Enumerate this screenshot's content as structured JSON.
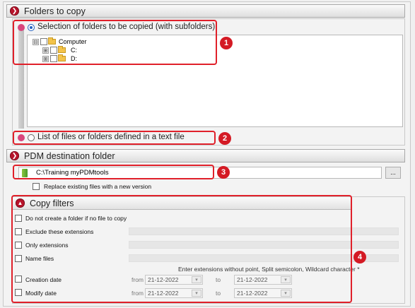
{
  "sections": {
    "folders_to_copy": {
      "title": "Folders to copy"
    },
    "pdm_destination": {
      "title": "PDM destination folder"
    },
    "copy_filters": {
      "title": "Copy filters"
    }
  },
  "source_options": {
    "selection_label": "Selection of folders to be copied (with subfolders)",
    "list_file_label": "List of files or folders defined in a text file",
    "selected": "selection"
  },
  "tree": {
    "root": {
      "label": "Computer",
      "expander": "⊟"
    },
    "children": [
      {
        "label": "C:",
        "expander": "⊞"
      },
      {
        "label": "D:",
        "expander": "⊞"
      }
    ]
  },
  "destination": {
    "path": "C:\\Training myPDMtools",
    "browse_label": "...",
    "replace_label": "Replace existing files with a new version"
  },
  "filters": {
    "no_folder_label": "Do not create a folder if no file to copy",
    "exclude_label": "Exclude these extensions",
    "only_label": "Only extensions",
    "name_label": "Name files",
    "hint": "Enter extensions without point, Split semicolon, Wildcard character *",
    "creation_label": "Creation date",
    "modify_label": "Modify date",
    "from_label": "from",
    "to_label": "to",
    "creation_from": "21-12-2022",
    "creation_to": "21-12-2022",
    "modify_from": "21-12-2022",
    "modify_to": "21-12-2022"
  },
  "callouts": [
    "1",
    "2",
    "3",
    "4"
  ],
  "colors": {
    "callout_red": "#e0202a",
    "badge_red": "#d41a24",
    "section_icon": "#b8142b",
    "radio_selected": "#1f5fbf"
  },
  "icons": {
    "section_collapse": "chevron-right-icon",
    "section_expand": "chevron-up-icon",
    "tree_folder": "folder-icon",
    "destination_folder": "pdm-folder-icon",
    "calendar": "calendar-icon"
  }
}
